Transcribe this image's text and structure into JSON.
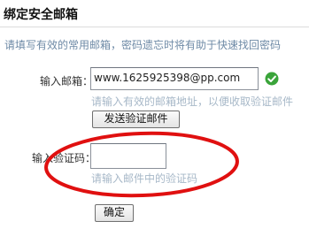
{
  "title": "绑定安全邮箱",
  "hint": "请填写有效的常用邮箱，密码遗忘时将有助于快速找回密码",
  "email": {
    "label": "输入邮箱：",
    "value": "www.1625925398@pp.com",
    "hint": "请输入有效的邮箱地址，以便收取验证邮件",
    "status_icon": "check-icon",
    "status_color": "#3aa43a"
  },
  "send_button": {
    "label": "发送验证邮件"
  },
  "code": {
    "label": "输入验证码：",
    "value": "",
    "hint": "请输入邮件中的验证码"
  },
  "confirm_button": {
    "label": "确定"
  },
  "annotation": {
    "shape": "ellipse",
    "color": "#e01010"
  }
}
